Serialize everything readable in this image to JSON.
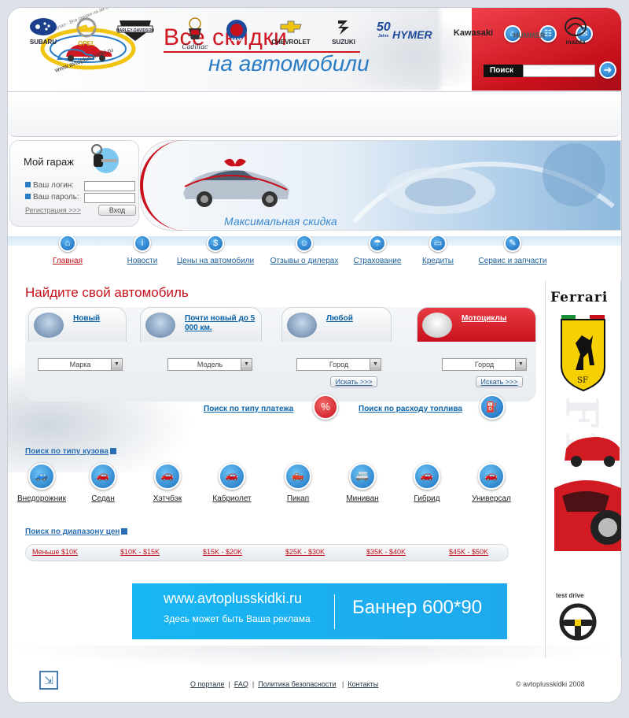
{
  "header": {
    "logo_url_text": "www.avtoplusskidki.ru",
    "logo_arc_text": "Портал - Все скидки на автомобили",
    "title_line1": "Все скидки",
    "title_line2": "на автомобили",
    "icons": [
      "home-icon",
      "sitemap-icon",
      "mail-icon"
    ],
    "search_label": "Поиск",
    "search_value": "",
    "search_go_icon": "arrow-right-icon"
  },
  "brands": [
    "SUBARU",
    "OPEL",
    "HARLEY-DAVIDSON",
    "Cadillac",
    "SAAB",
    "CHEVROLET",
    "SUZUKI",
    "HYMER",
    "Kawasaki",
    "HUMMER",
    "mazda"
  ],
  "hymer_years": "50",
  "hymer_sub": "Jahre",
  "harley_sub": "MOTOR CYCLES",
  "garage": {
    "title": "Мой гараж",
    "login_label": "Ваш логин:",
    "password_label": "Ваш пароль:",
    "register": "Регистрация >>>",
    "enter": "Вход"
  },
  "banner": {
    "caption": "Максимальная скидка"
  },
  "nav": {
    "items": [
      {
        "label": "Главная",
        "icon": "home-icon",
        "active": true
      },
      {
        "label": "Новости",
        "icon": "info-icon"
      },
      {
        "label": "Цены на автомобили",
        "icon": "dollar-icon"
      },
      {
        "label": "Отзывы о дилерах",
        "icon": "person-icon"
      },
      {
        "label": "Страхование",
        "icon": "umbrella-icon"
      },
      {
        "label": "Кредиты",
        "icon": "card-icon"
      },
      {
        "label": "Сервис и запчасти",
        "icon": "wrench-icon"
      }
    ]
  },
  "find": {
    "title": "Найдите свой автомобиль",
    "tabs": [
      {
        "label": "Новый"
      },
      {
        "label": "Почти новый до 5 000 км."
      },
      {
        "label": "Любой"
      },
      {
        "label": "Мотоциклы"
      }
    ],
    "selects": [
      "Марка",
      "Модель",
      "Город",
      "Город"
    ],
    "search_btn": "Искать >>>",
    "pay_link": "Поиск по типу платежа",
    "fuel_link": "Поиск по расходу топлива",
    "pay_icon_text": "%"
  },
  "body_types": {
    "title": "Поиск по типу кузова",
    "items": [
      "Внедорожник",
      "Седан",
      "Хэтчбэк",
      "Кабриолет",
      "Пикап",
      "Миниван",
      "Гибрид",
      "Универсал"
    ]
  },
  "price_ranges": {
    "title": "Поиск по диапазону цен",
    "items": [
      "Меньше  $10K",
      "$10K - $15K",
      "$15K - $20K",
      "$25K - $30K",
      "$35K - $40K",
      "$45K - $50K"
    ]
  },
  "ad": {
    "url": "www.avtoplusskidki.ru",
    "slogan": "Здесь может быть Ваша реклама",
    "size": "Баннер 600*90"
  },
  "side": {
    "brand": "Ferrari",
    "shield_letters": "SF",
    "test_drive": "test drive",
    "f1_text": "F1"
  },
  "footer": {
    "links": [
      "О портале",
      "FAQ",
      "Политика безопасности",
      "Контакты"
    ],
    "sep": "|",
    "copyright": "© avtoplusskidki 2008"
  },
  "colors": {
    "brand_red": "#c8101c",
    "link_blue": "#0a63a8",
    "accent_blue": "#1fa9ec"
  }
}
